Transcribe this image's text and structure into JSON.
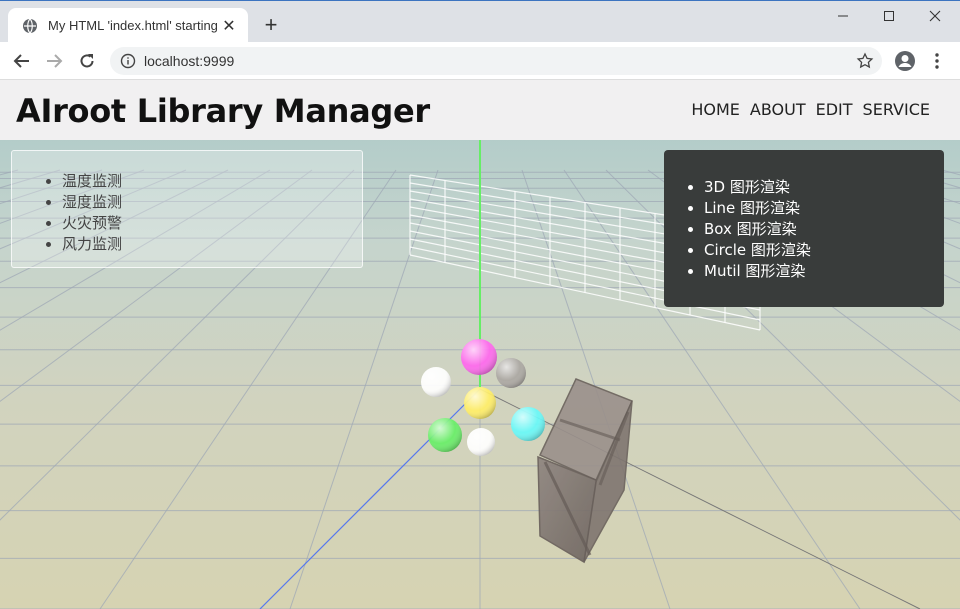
{
  "browser": {
    "tab_title": "My HTML 'index.html' starting",
    "tab_close": "✕",
    "new_tab": "+",
    "url": "localhost:9999"
  },
  "site": {
    "title": "AIroot Library Manager",
    "nav": [
      "HOME",
      "ABOUT",
      "EDIT",
      "SERVICE"
    ]
  },
  "left_panel": {
    "items": [
      "温度监测",
      "湿度监测",
      "火灾预警",
      "风力监测"
    ]
  },
  "right_panel": {
    "items": [
      "3D 图形渲染",
      "Line 图形渲染",
      "Box 图形渲染",
      "Circle 图形渲染",
      "Mutil 图形渲染"
    ]
  },
  "scene": {
    "sphere_colors": [
      "#ff66ee",
      "#aaa6a2",
      "#ffffff",
      "#ffee66",
      "#66f8f8",
      "#66ee66",
      "#ffffff"
    ],
    "axis_colors": {
      "y": "#66ee66",
      "z": "#5577ee"
    },
    "box_color": "#8a7e78"
  }
}
